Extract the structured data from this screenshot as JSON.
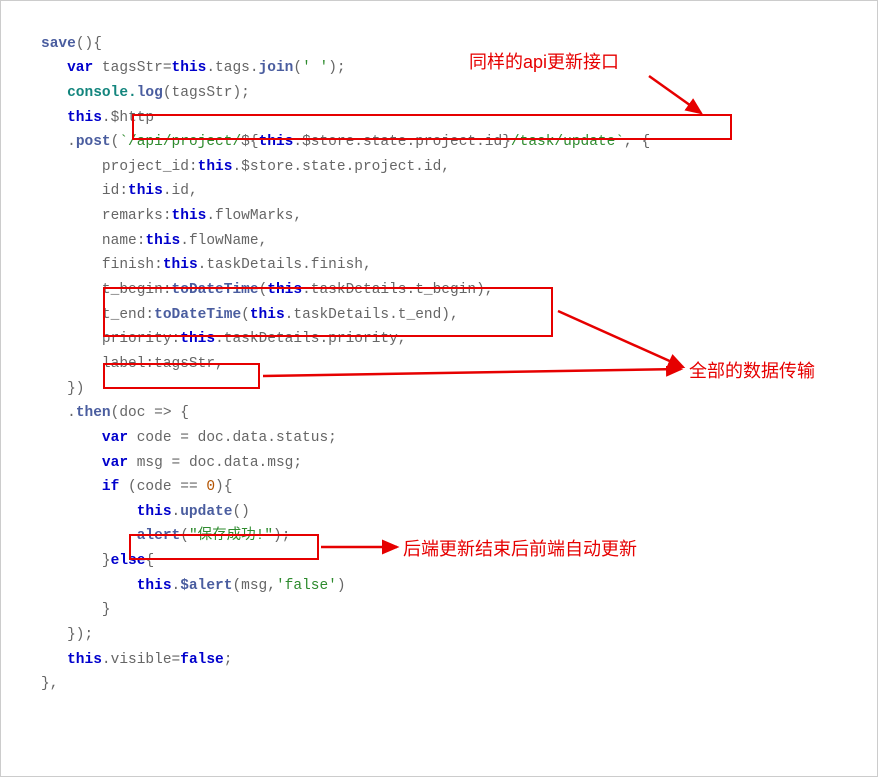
{
  "code": {
    "l1_fn": "save",
    "l1_rest": "(){",
    "l2_var": "var",
    "l2_a": " tagsStr=",
    "l2_this": "this",
    "l2_b": ".tags.",
    "l2_join": "join",
    "l2_c": "(",
    "l2_str": "' '",
    "l2_d": ");",
    "l3_a": "console.",
    "l3_log": "log",
    "l3_b": "(tagsStr);",
    "l4_this": "this",
    "l4_a": ".$http",
    "l5_a": ".",
    "l5_post": "post",
    "l5_b": "(",
    "l5_tick1": "`",
    "l5_str1": "/api/project/",
    "l5_int1": "${",
    "l5_this": "this",
    "l5_int2": ".$store.state.project.id}",
    "l5_str2": "/task/update",
    "l5_tick2": "`",
    "l5_c": ", {",
    "l6_a": "project_id:",
    "l6_this": "this",
    "l6_b": ".$store.state.project.id,",
    "l7_a": "id:",
    "l7_this": "this",
    "l7_b": ".id,",
    "l8_a": "remarks:",
    "l8_this": "this",
    "l8_b": ".flowMarks,",
    "l9_a": "name:",
    "l9_this": "this",
    "l9_b": ".flowName,",
    "l10_a": "finish:",
    "l10_this": "this",
    "l10_b": ".taskDetails.finish,",
    "l11_a": "t_begin:",
    "l11_fn": "toDateTime",
    "l11_b": "(",
    "l11_this": "this",
    "l11_c": ".taskDetails.t_begin),",
    "l12_a": "t_end:",
    "l12_fn": "toDateTime",
    "l12_b": "(",
    "l12_this": "this",
    "l12_c": ".taskDetails.t_end),",
    "l13_a": "priority:",
    "l13_this": "this",
    "l13_b": ".taskDetails.priority,",
    "l14_a": "label:tagsStr,",
    "l15_a": "})",
    "l16_a": ".",
    "l16_then": "then",
    "l16_b": "(doc => {",
    "l17_var": "var",
    "l17_a": " code = doc.data.status;",
    "l18_var": "var",
    "l18_a": " msg = doc.data.msg;",
    "l19_if": "if",
    "l19_a": " (code == ",
    "l19_num": "0",
    "l19_b": "){",
    "l20_this": "this",
    "l20_a": ".",
    "l20_upd": "update",
    "l20_b": "()",
    "l21_fn": "alert",
    "l21_a": "(",
    "l21_str": "\"保存成功!\"",
    "l21_b": ");",
    "l22_a": "}",
    "l22_else": "else",
    "l22_b": "{",
    "l23_this": "this",
    "l23_a": ".",
    "l23_alert": "$alert",
    "l23_b": "(msg,",
    "l23_str": "'false'",
    "l23_c": ")",
    "l24_a": "}",
    "l25_a": "});",
    "l26_this": "this",
    "l26_a": ".visible=",
    "l26_false": "false",
    "l26_b": ";",
    "l27_a": "},"
  },
  "annotations": {
    "a1": "同样的api更新接口",
    "a2": "全部的数据传输",
    "a3": "后端更新结束后前端自动更新"
  }
}
